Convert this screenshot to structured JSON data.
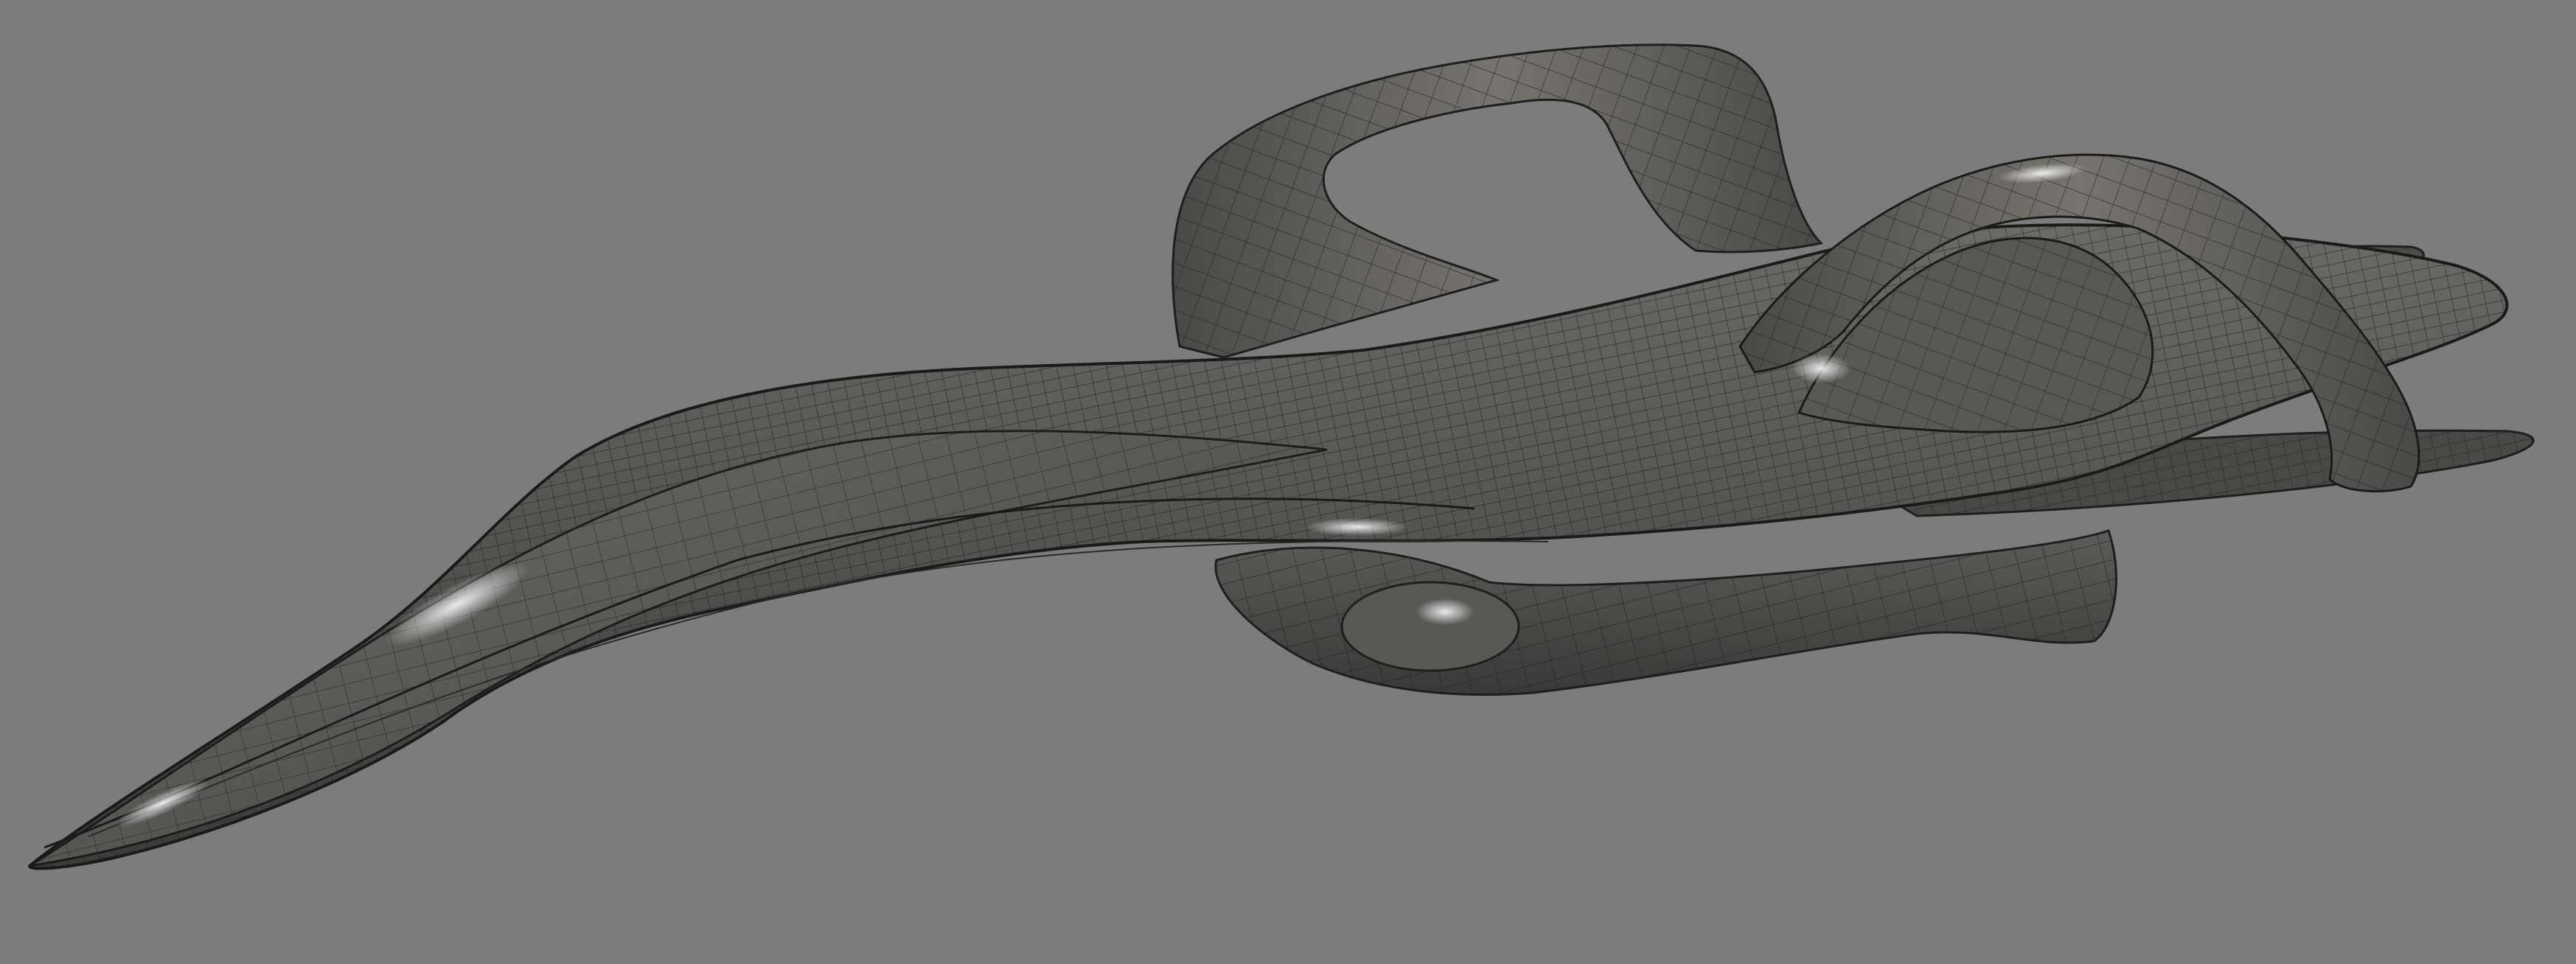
{
  "viewport": {
    "background_color": "#7c7c7c",
    "mode": "shaded-with-wireframe",
    "subject": "freeform-surface-vehicle-model"
  },
  "model": {
    "surface_color": "#5c5a57",
    "surface_highlight": "#d8d8d8",
    "edge_color": "#1e1e1e",
    "wire_color": "#242424",
    "parts": [
      "nose-spine",
      "main-hull",
      "underside-pod",
      "rear-left-arch",
      "rear-right-arch",
      "tail-wing"
    ]
  }
}
